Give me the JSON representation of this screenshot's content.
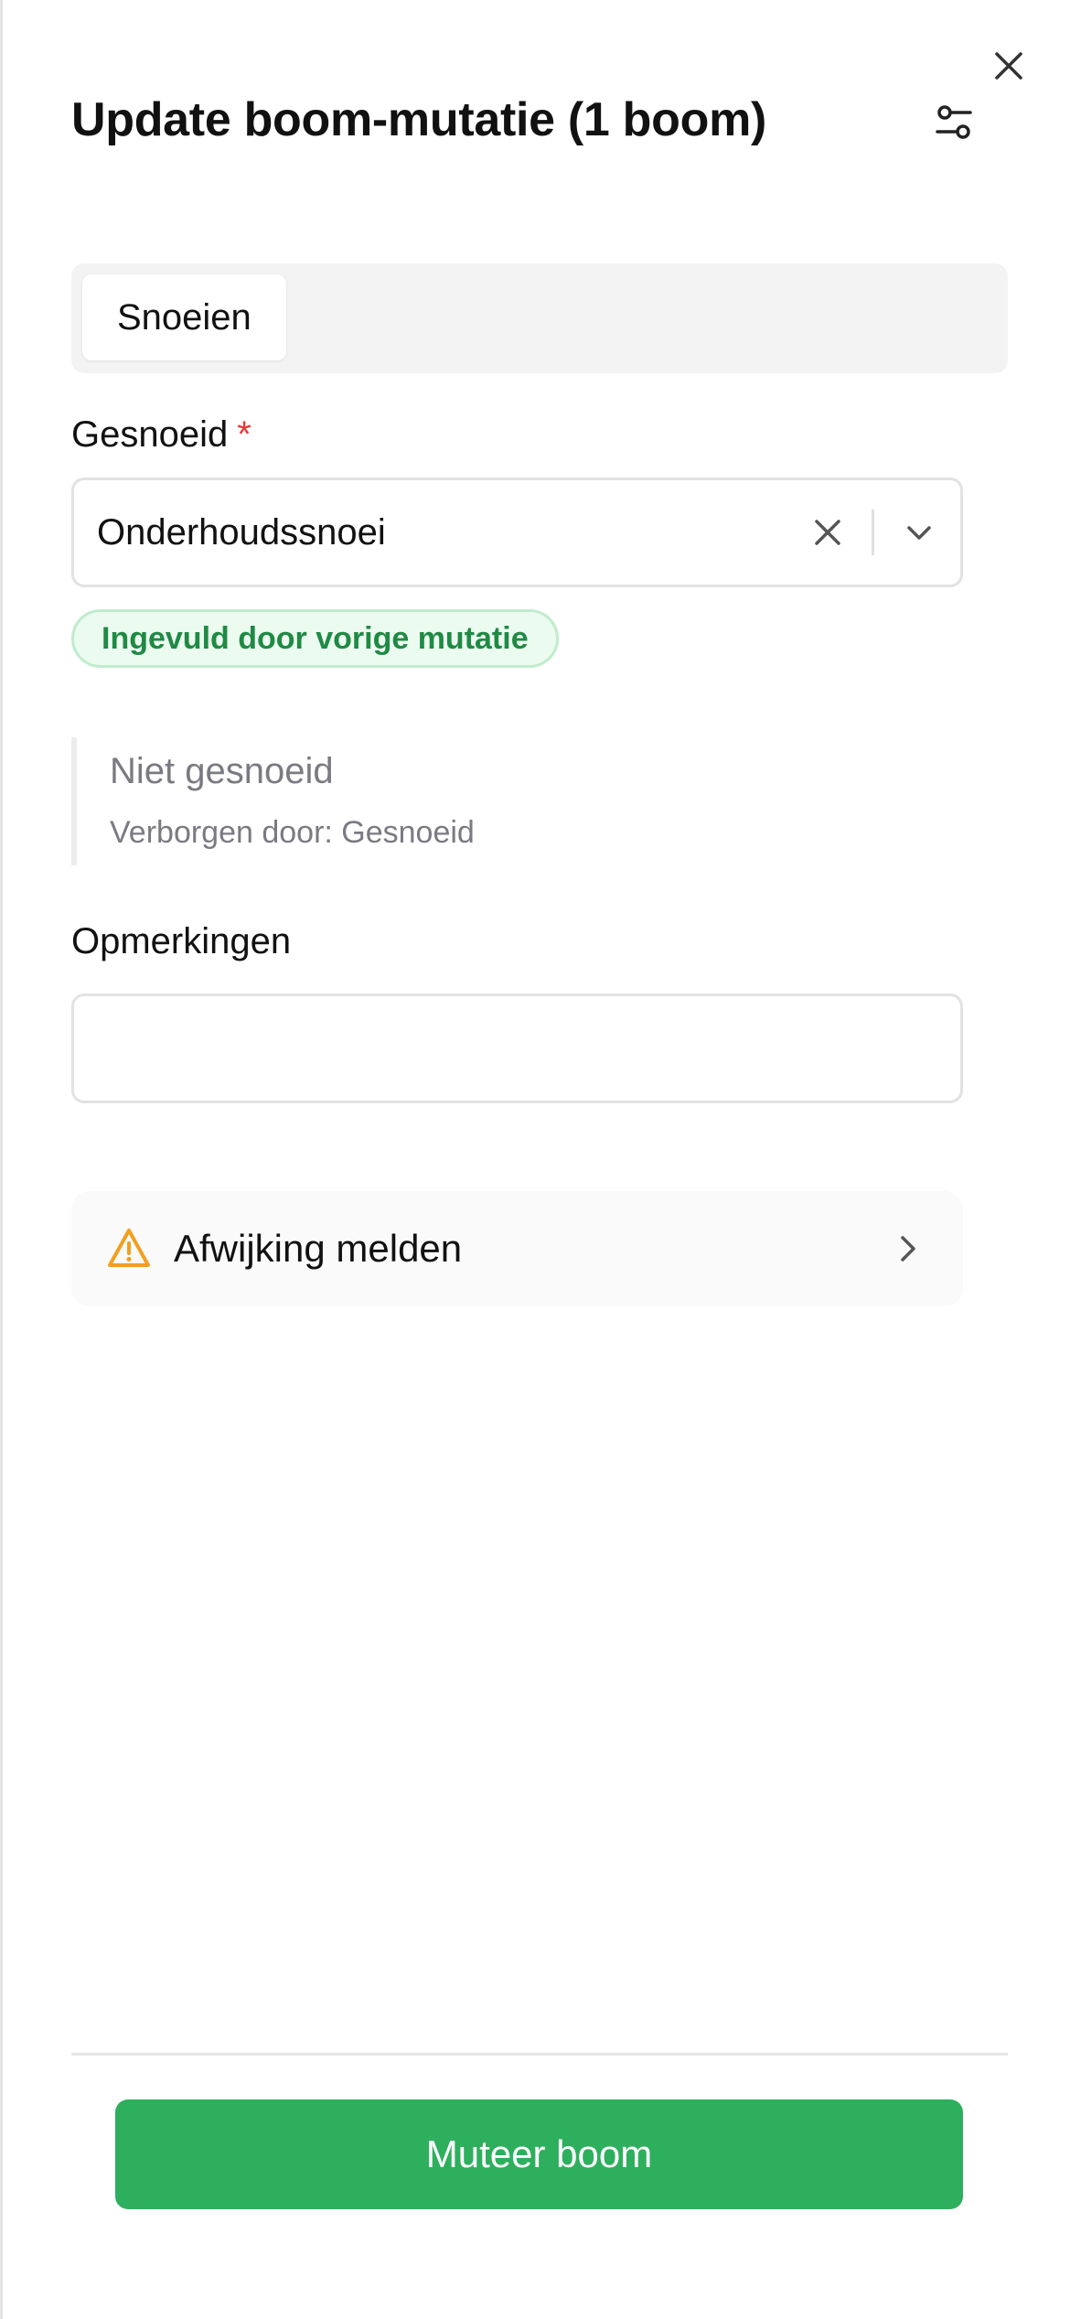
{
  "header": {
    "title": "Update boom-mutatie (1 boom)",
    "close_icon": "close-icon",
    "settings_icon": "sliders-icon"
  },
  "tabs": [
    {
      "label": "Snoeien",
      "active": true
    }
  ],
  "gesnoeid": {
    "label": "Gesnoeid",
    "required_marker": "*",
    "value": "Onderhoudssnoei",
    "badge": "Ingevuld door vorige mutatie"
  },
  "hidden_field": {
    "title": "Niet gesnoeid",
    "subtitle": "Verborgen door: Gesnoeid"
  },
  "opmerkingen": {
    "label": "Opmerkingen",
    "value": "",
    "placeholder": ""
  },
  "deviation": {
    "label": "Afwijking melden",
    "icon": "warning-icon"
  },
  "footer": {
    "submit_label": "Muteer boom"
  },
  "colors": {
    "primary": "#2eaf5d",
    "badge_text": "#1f8a44",
    "badge_bg": "#ecfbf0",
    "required": "#e53935",
    "warning": "#f0a020",
    "muted_text": "#7a7a82"
  }
}
